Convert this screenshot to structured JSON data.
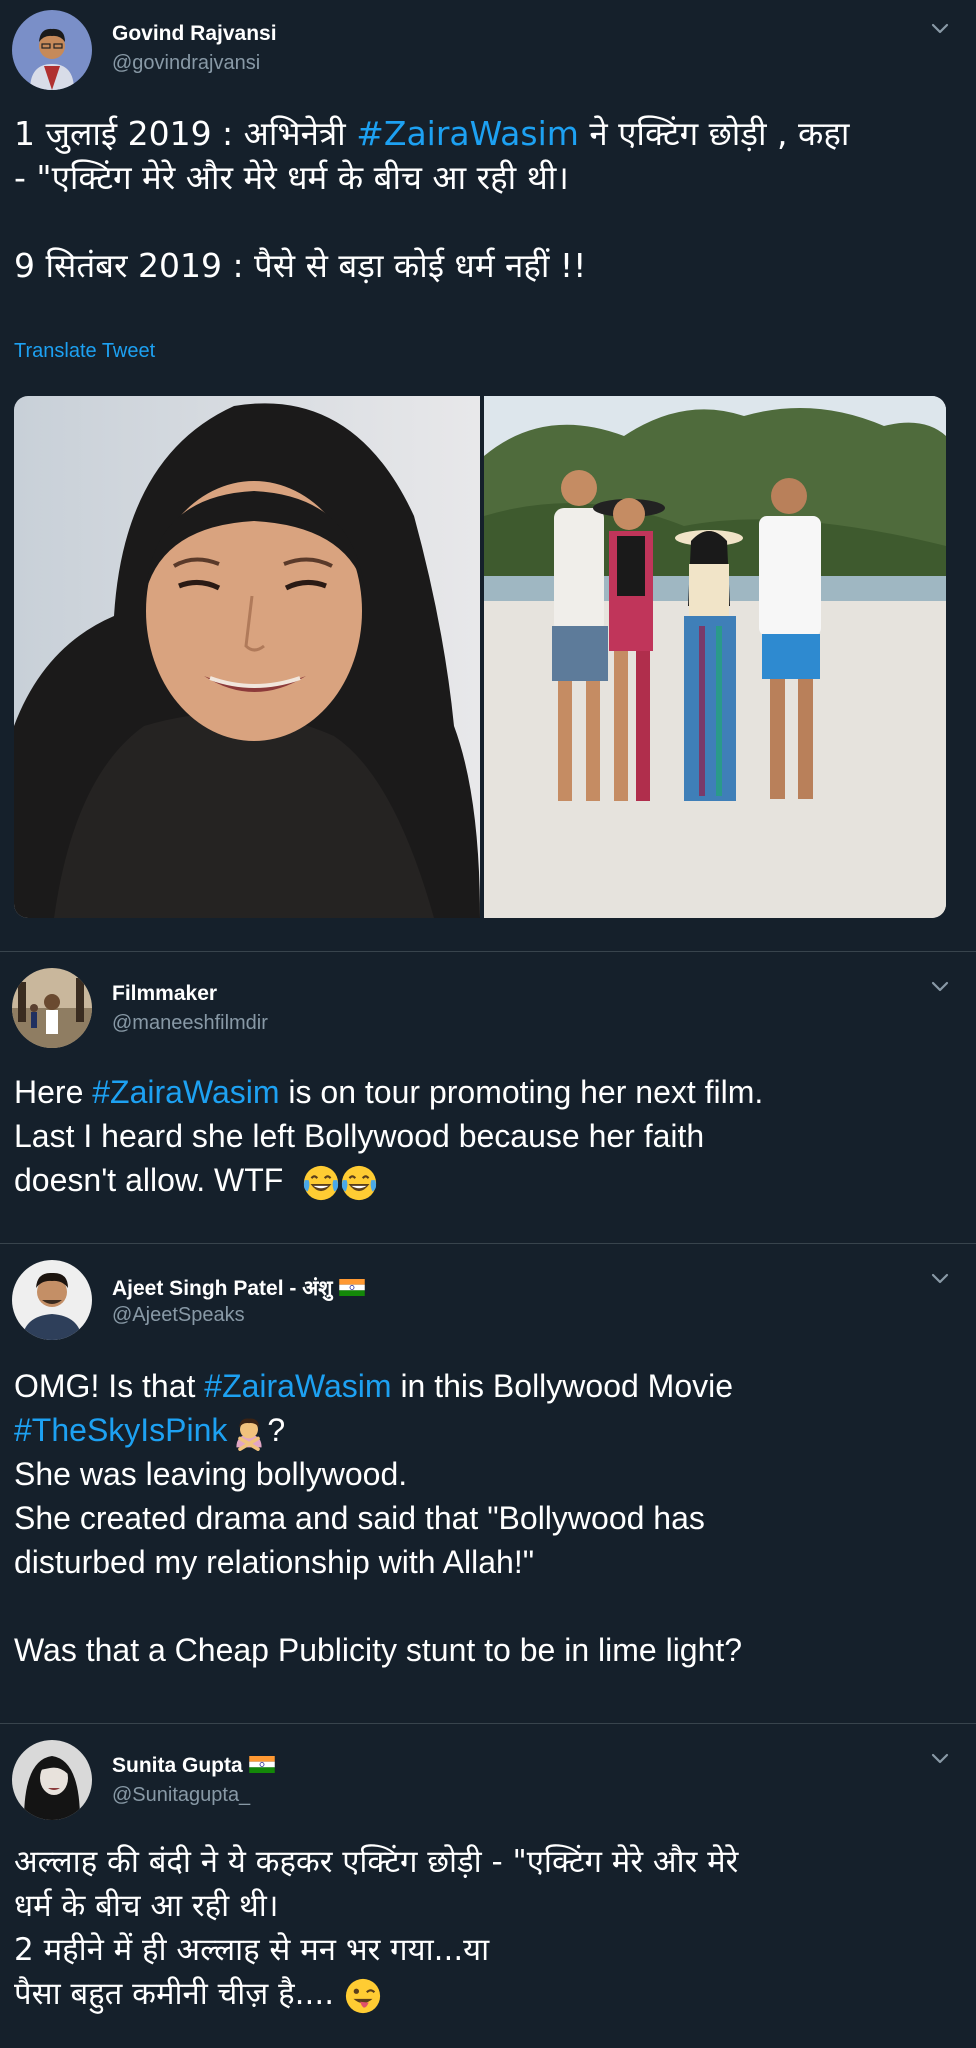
{
  "tweets": [
    {
      "name": "Govind Rajvansi",
      "handle": "@govindrajvansi",
      "line1_a": "1 जुलाई 2019 : अभिनेत्री ",
      "line1_hashtag": "#ZairaWasim",
      "line1_b": " ने एक्टिंग छोड़ी , कहा",
      "line2": "- \"एक्टिंग मेरे और मेरे धर्म के बीच आ रही थी।",
      "line3": "9 सितंबर 2019 : पैसे से बड़ा कोई धर्म नहीं !!",
      "translate_label": "Translate Tweet",
      "image_left_alt": "Woman wearing black hijab",
      "image_right_alt": "Group of four people on a beach"
    },
    {
      "name": "Filmmaker",
      "handle": "@maneeshfilmdir",
      "line1_a": "Here ",
      "line1_hashtag": "#ZairaWasim",
      "line1_b": " is on tour promoting her next film.",
      "line2": "Last I heard she left Bollywood because her faith",
      "line3": "doesn't allow. WTF",
      "emoji": "face-with-tears-of-joy"
    },
    {
      "name": "Ajeet Singh Patel - अंशु",
      "handle": "@AjeetSpeaks",
      "line1_a": "OMG! Is that ",
      "line1_hashtag": "#ZairaWasim",
      "line1_b": " in this Bollywood Movie",
      "line2_hashtag": "#TheSkyIsPink",
      "line2_b": "?",
      "line3": "She was leaving bollywood.",
      "line4": "She created drama and said that \"Bollywood has",
      "line5": "disturbed my relationship with Allah!\"",
      "line6": "Was that a Cheap Publicity stunt to be in lime light?",
      "emoji": "person-gesturing-no",
      "flag": "india-flag"
    },
    {
      "name": "Sunita Gupta",
      "handle": "@Sunitagupta_",
      "line1": "अल्लाह की बंदी ने ये कहकर एक्टिंग छोड़ी - \"एक्टिंग मेरे और मेरे",
      "line2": "धर्म के बीच आ रही थी।",
      "line3": "2 महीने में ही अल्लाह से मन भर गया...या",
      "line4": "पैसा बहुत कमीनी चीज़ है....",
      "emoji": "winking-face-with-tongue",
      "flag": "india-flag"
    }
  ],
  "colors": {
    "background": "#15202b",
    "text": "#ffffff",
    "secondary": "#8899a6",
    "link": "#1da1f2",
    "divider": "#38444d"
  }
}
